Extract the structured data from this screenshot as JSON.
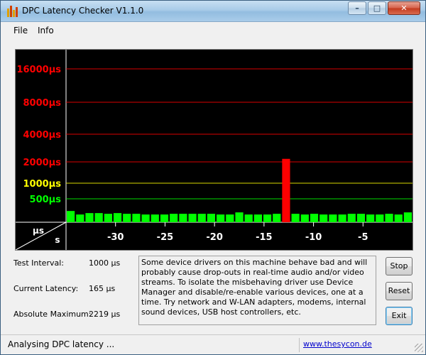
{
  "window": {
    "title": "DPC Latency Checker V1.1.0",
    "controls": {
      "minimize": "–",
      "maximize": "□",
      "close": "✕"
    }
  },
  "menu": {
    "items": [
      "File",
      "Info"
    ]
  },
  "chart_data": {
    "type": "bar",
    "y_axis_unit": "µs",
    "x_axis_unit": "s",
    "y_ticks": [
      {
        "label": "16000µs",
        "value": 16000,
        "color": "#ff0000"
      },
      {
        "label": "8000µs",
        "value": 8000,
        "color": "#ff0000"
      },
      {
        "label": "4000µs",
        "value": 4000,
        "color": "#ff0000"
      },
      {
        "label": "2000µs",
        "value": 2000,
        "color": "#ff0000"
      },
      {
        "label": "1000µs",
        "value": 1000,
        "color": "#ffff00"
      },
      {
        "label": "500µs",
        "value": 500,
        "color": "#00ff00"
      }
    ],
    "x_ticks": [
      "-30",
      "-25",
      "-20",
      "-15",
      "-10",
      "-5"
    ],
    "x_tick_values": [
      -30,
      -25,
      -20,
      -15,
      -10,
      -5
    ],
    "x_range": [
      -35,
      0
    ],
    "values": [
      240,
      165,
      195,
      195,
      180,
      195,
      180,
      180,
      165,
      165,
      165,
      180,
      180,
      180,
      180,
      180,
      165,
      165,
      210,
      165,
      165,
      165,
      180,
      2219,
      180,
      165,
      180,
      165,
      165,
      165,
      180,
      180,
      165,
      165,
      180,
      165,
      210
    ],
    "bar_colors": {
      "normal": "#00ff00",
      "critical": "#ff0000"
    },
    "critical_threshold": 2000
  },
  "stats": {
    "test_interval_label": "Test Interval:",
    "test_interval_value": "1000 µs",
    "current_latency_label": "Current Latency:",
    "current_latency_value": "165 µs",
    "absolute_maximum_label": "Absolute Maximum:",
    "absolute_maximum_value": "2219 µs"
  },
  "info_text": "Some device drivers on this machine behave bad and will probably cause drop-outs in real-time audio and/or video streams. To isolate the misbehaving driver use Device Manager and disable/re-enable various devices, one at a time. Try network and W-LAN adapters, modems, internal sound devices, USB host controllers, etc.",
  "buttons": {
    "stop": "Stop",
    "reset": "Reset",
    "exit": "Exit"
  },
  "status": {
    "text": "Analysing DPC latency ...",
    "link": "www.thesycon.de"
  }
}
